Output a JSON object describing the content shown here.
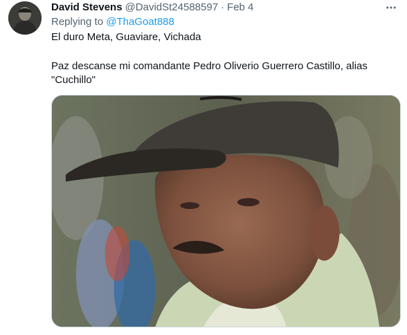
{
  "author": {
    "name": "David Stevens",
    "handle": "@DavidSt24588597",
    "separator": "·",
    "date": "Feb 4"
  },
  "reply": {
    "prefix": "Replying to",
    "target": "@ThaGoat888"
  },
  "body": {
    "line1": "El duro Meta, Guaviare, Vichada",
    "line2": "Paz descanse mi comandante Pedro Oliverio Guerrero Castillo, alias \"Cuchillo\""
  },
  "icons": {
    "avatar": "avatar-icon",
    "more": "more-options-icon"
  },
  "colors": {
    "accent": "#1d9bf0",
    "secondary_text": "#536471",
    "primary_text": "#0f1419"
  }
}
